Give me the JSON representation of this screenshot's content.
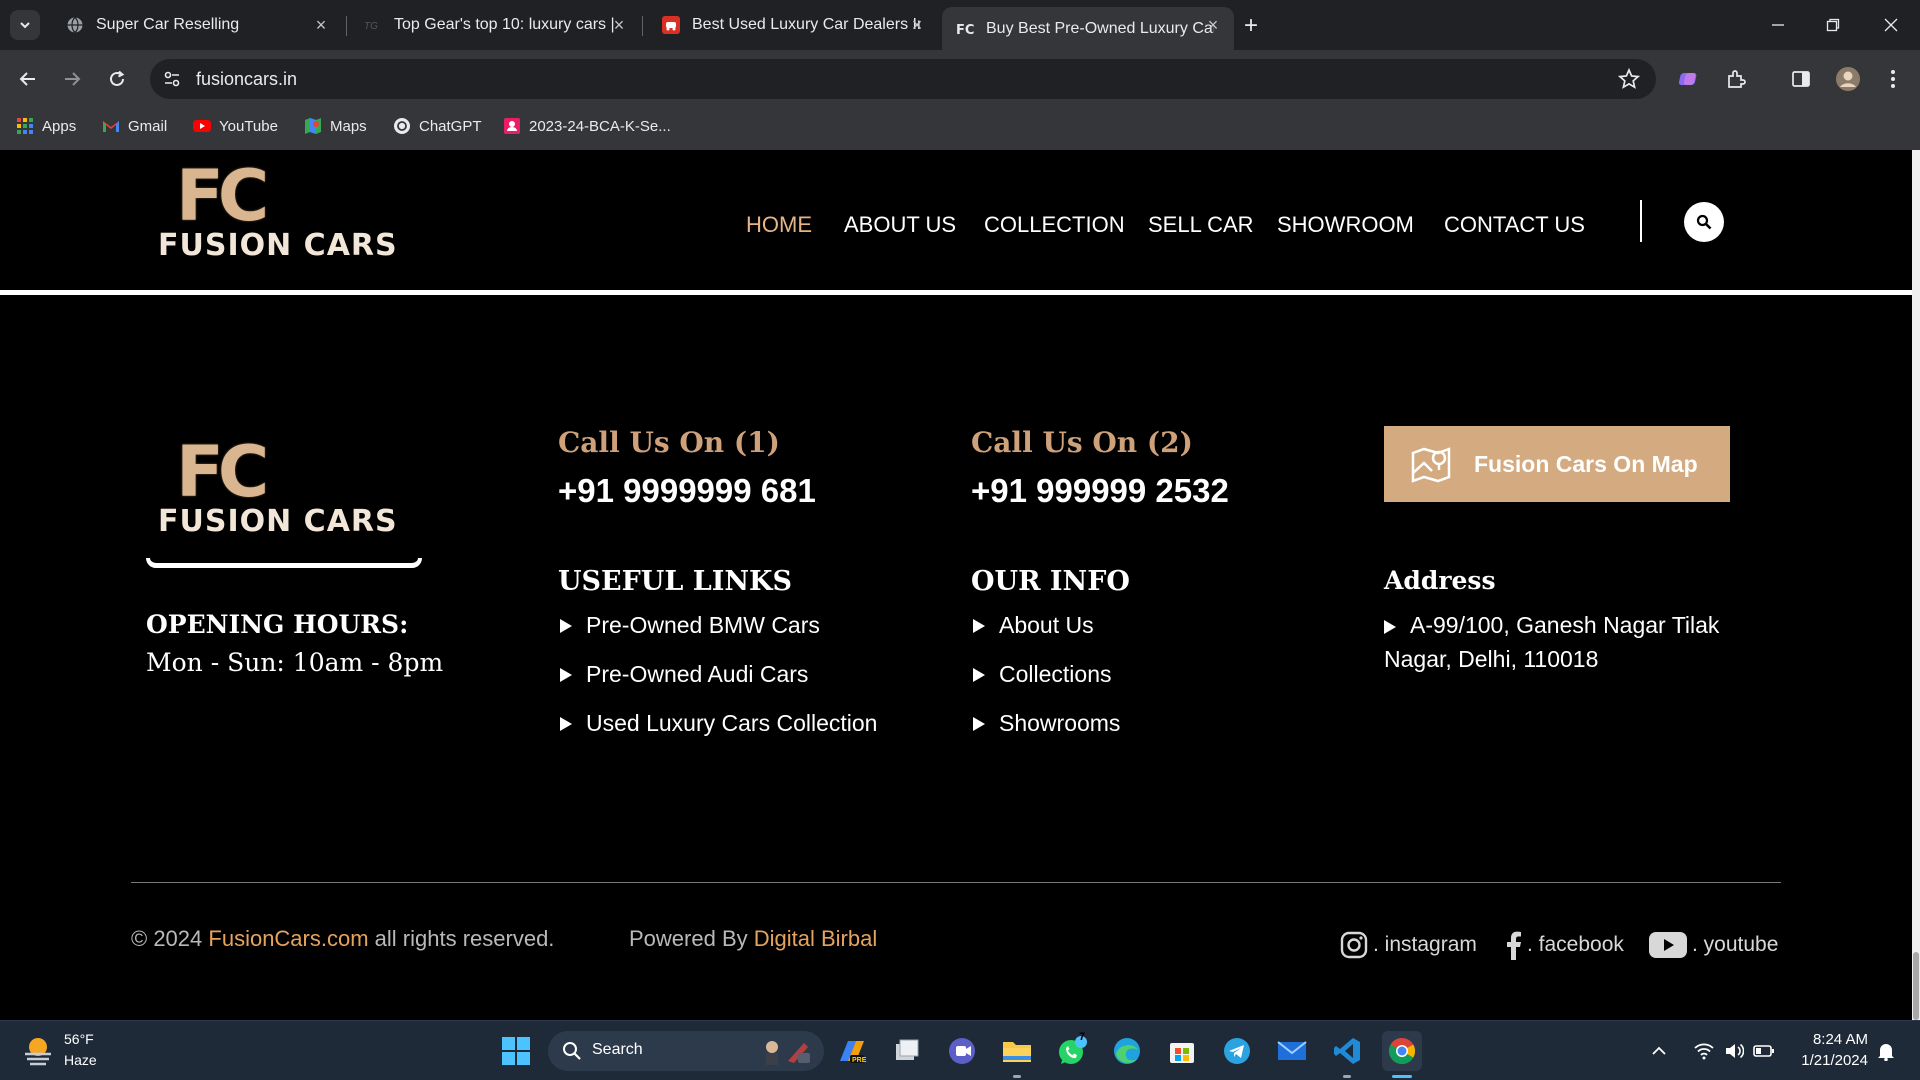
{
  "browser": {
    "tabs": [
      {
        "title": "Super Car Reselling",
        "active": false
      },
      {
        "title": "Top Gear's top 10: luxury cars |",
        "active": false
      },
      {
        "title": "Best Used Luxury Car Dealers In",
        "active": false
      },
      {
        "title": "Buy Best Pre-Owned Luxury Car",
        "active": true
      }
    ],
    "new_tab_symbol": "+",
    "url": "fusioncars.in",
    "bookmarks": [
      "Apps",
      "Gmail",
      "YouTube",
      "Maps",
      "ChatGPT",
      "2023-24-BCA-K-Se..."
    ]
  },
  "header": {
    "logo_mono": "FC",
    "logo_word": "FUSION CARS",
    "nav": [
      "HOME",
      "ABOUT US",
      "COLLECTION",
      "SELL CAR",
      "SHOWROOM",
      "CONTACT US"
    ],
    "active_nav": "HOME"
  },
  "footer": {
    "logo_mono": "FC",
    "logo_word": "FUSION CARS",
    "opening_title": "OPENING HOURS:",
    "opening_hours": "Mon - Sun: 10am - 8pm",
    "call1_title": "Call Us On (1)",
    "call1_phone": "+91 9999999 681",
    "call2_title": "Call Us On (2)",
    "call2_phone": "+91 999999 2532",
    "map_button": "Fusion Cars On Map",
    "useful_title": "USEFUL LINKS",
    "useful_links": [
      "Pre-Owned BMW Cars",
      "Pre-Owned Audi Cars",
      "Used Luxury Cars Collection"
    ],
    "info_title": "OUR INFO",
    "info_links": [
      "About Us",
      "Collections",
      "Showrooms"
    ],
    "address_title": "Address",
    "address": "A-99/100, Ganesh Nagar Tilak Nagar, Delhi, 110018",
    "copyright_pre": "© 2024",
    "copyright_brand": "FusionCars.com",
    "copyright_post": "all rights reserved.",
    "powered_pre": "Powered By",
    "powered_brand": "Digital Birbal",
    "social": [
      ". instagram",
      ". facebook",
      ". youtube"
    ]
  },
  "taskbar": {
    "weather_temp": "56°F",
    "weather_cond": "Haze",
    "search_label": "Search",
    "whatsapp_badge": "7",
    "time": "8:24 AM",
    "date": "1/21/2024"
  },
  "colors": {
    "accent_gold": "#d4aa80",
    "nav_active": "#e6b485",
    "link_gold": "#e6a35c"
  }
}
